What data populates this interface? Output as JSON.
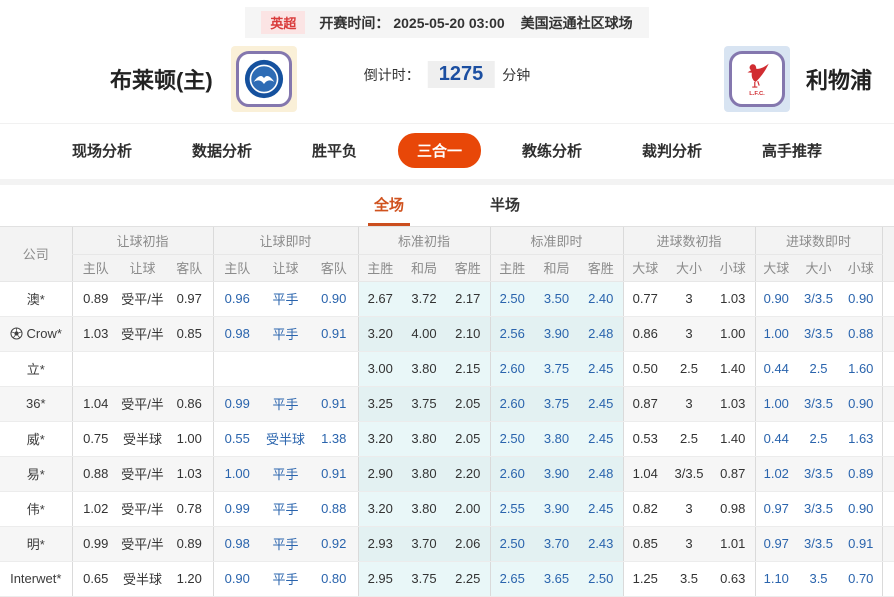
{
  "top_bar": {
    "league_badge": "英超",
    "kickoff_label": "开赛时间：",
    "kickoff_time": "2025-05-20 03:00",
    "venue": "美国运通社区球场"
  },
  "match": {
    "home_name": "布莱顿(主)",
    "away_name": "利物浦",
    "away_crest_caption": "L.F.C.",
    "countdown_label": "倒计时：",
    "countdown_value": "1275",
    "countdown_unit": "分钟"
  },
  "nav_tabs": [
    {
      "label": "现场分析",
      "active": false
    },
    {
      "label": "数据分析",
      "active": false
    },
    {
      "label": "胜平负",
      "active": false
    },
    {
      "label": "三合一",
      "active": true
    },
    {
      "label": "教练分析",
      "active": false
    },
    {
      "label": "裁判分析",
      "active": false
    },
    {
      "label": "高手推荐",
      "active": false
    }
  ],
  "sub_tabs": [
    {
      "label": "全场",
      "active": true
    },
    {
      "label": "半场",
      "active": false
    }
  ],
  "table": {
    "company_header": "公司",
    "groups": [
      {
        "label": "让球初指",
        "cols": [
          "主队",
          "让球",
          "客队"
        ]
      },
      {
        "label": "让球即时",
        "cols": [
          "主队",
          "让球",
          "客队"
        ]
      },
      {
        "label": "标准初指",
        "cols": [
          "主胜",
          "和局",
          "客胜"
        ]
      },
      {
        "label": "标准即时",
        "cols": [
          "主胜",
          "和局",
          "客胜"
        ]
      },
      {
        "label": "进球数初指",
        "cols": [
          "大球",
          "大小",
          "小球"
        ]
      },
      {
        "label": "进球数即时",
        "cols": [
          "大球",
          "大小",
          "小球"
        ]
      }
    ],
    "rows": [
      {
        "company": "澳*",
        "has_ball_icon": false,
        "cells": [
          "0.89",
          "受平/半",
          "0.97",
          "0.96",
          "平手",
          "0.90",
          "2.67",
          "3.72",
          "2.17",
          "2.50",
          "3.50",
          "2.40",
          "0.77",
          "3",
          "1.03",
          "0.90",
          "3/3.5",
          "0.90"
        ]
      },
      {
        "company": "Crow*",
        "has_ball_icon": true,
        "cells": [
          "1.03",
          "受平/半",
          "0.85",
          "0.98",
          "平手",
          "0.91",
          "3.20",
          "4.00",
          "2.10",
          "2.56",
          "3.90",
          "2.48",
          "0.86",
          "3",
          "1.00",
          "1.00",
          "3/3.5",
          "0.88"
        ]
      },
      {
        "company": "立*",
        "has_ball_icon": false,
        "cells": [
          "",
          "",
          "",
          "",
          "",
          "",
          "3.00",
          "3.80",
          "2.15",
          "2.60",
          "3.75",
          "2.45",
          "0.50",
          "2.5",
          "1.40",
          "0.44",
          "2.5",
          "1.60"
        ]
      },
      {
        "company": "36*",
        "has_ball_icon": false,
        "cells": [
          "1.04",
          "受平/半",
          "0.86",
          "0.99",
          "平手",
          "0.91",
          "3.25",
          "3.75",
          "2.05",
          "2.60",
          "3.75",
          "2.45",
          "0.87",
          "3",
          "1.03",
          "1.00",
          "3/3.5",
          "0.90"
        ]
      },
      {
        "company": "威*",
        "has_ball_icon": false,
        "cells": [
          "0.75",
          "受半球",
          "1.00",
          "0.55",
          "受半球",
          "1.38",
          "3.20",
          "3.80",
          "2.05",
          "2.50",
          "3.80",
          "2.45",
          "0.53",
          "2.5",
          "1.40",
          "0.44",
          "2.5",
          "1.63"
        ]
      },
      {
        "company": "易*",
        "has_ball_icon": false,
        "cells": [
          "0.88",
          "受平/半",
          "1.03",
          "1.00",
          "平手",
          "0.91",
          "2.90",
          "3.80",
          "2.20",
          "2.60",
          "3.90",
          "2.48",
          "1.04",
          "3/3.5",
          "0.87",
          "1.02",
          "3/3.5",
          "0.89"
        ]
      },
      {
        "company": "伟*",
        "has_ball_icon": false,
        "cells": [
          "1.02",
          "受平/半",
          "0.78",
          "0.99",
          "平手",
          "0.88",
          "3.20",
          "3.80",
          "2.00",
          "2.55",
          "3.90",
          "2.45",
          "0.82",
          "3",
          "0.98",
          "0.97",
          "3/3.5",
          "0.90"
        ]
      },
      {
        "company": "明*",
        "has_ball_icon": false,
        "cells": [
          "0.99",
          "受平/半",
          "0.89",
          "0.98",
          "平手",
          "0.92",
          "2.93",
          "3.70",
          "2.06",
          "2.50",
          "3.70",
          "2.43",
          "0.85",
          "3",
          "1.01",
          "0.97",
          "3/3.5",
          "0.91"
        ]
      },
      {
        "company": "Interwet*",
        "has_ball_icon": false,
        "cells": [
          "0.65",
          "受半球",
          "1.20",
          "0.90",
          "平手",
          "0.80",
          "2.95",
          "3.75",
          "2.25",
          "2.65",
          "3.65",
          "2.50",
          "1.25",
          "3.5",
          "0.63",
          "1.10",
          "3.5",
          "0.70"
        ]
      }
    ]
  },
  "colors": {
    "accent_orange": "#e84708",
    "tab_orange": "#d0521e",
    "live_blue": "#2a64ad",
    "countdown_blue": "#1c4fa1",
    "badge_red": "#d93b3b",
    "badge_red_bg": "#fbe4e4",
    "cyan_column_bg": "#e9f7f8",
    "header_bg": "#f3f3f3",
    "alt_row_bg": "#f6f6f6"
  }
}
